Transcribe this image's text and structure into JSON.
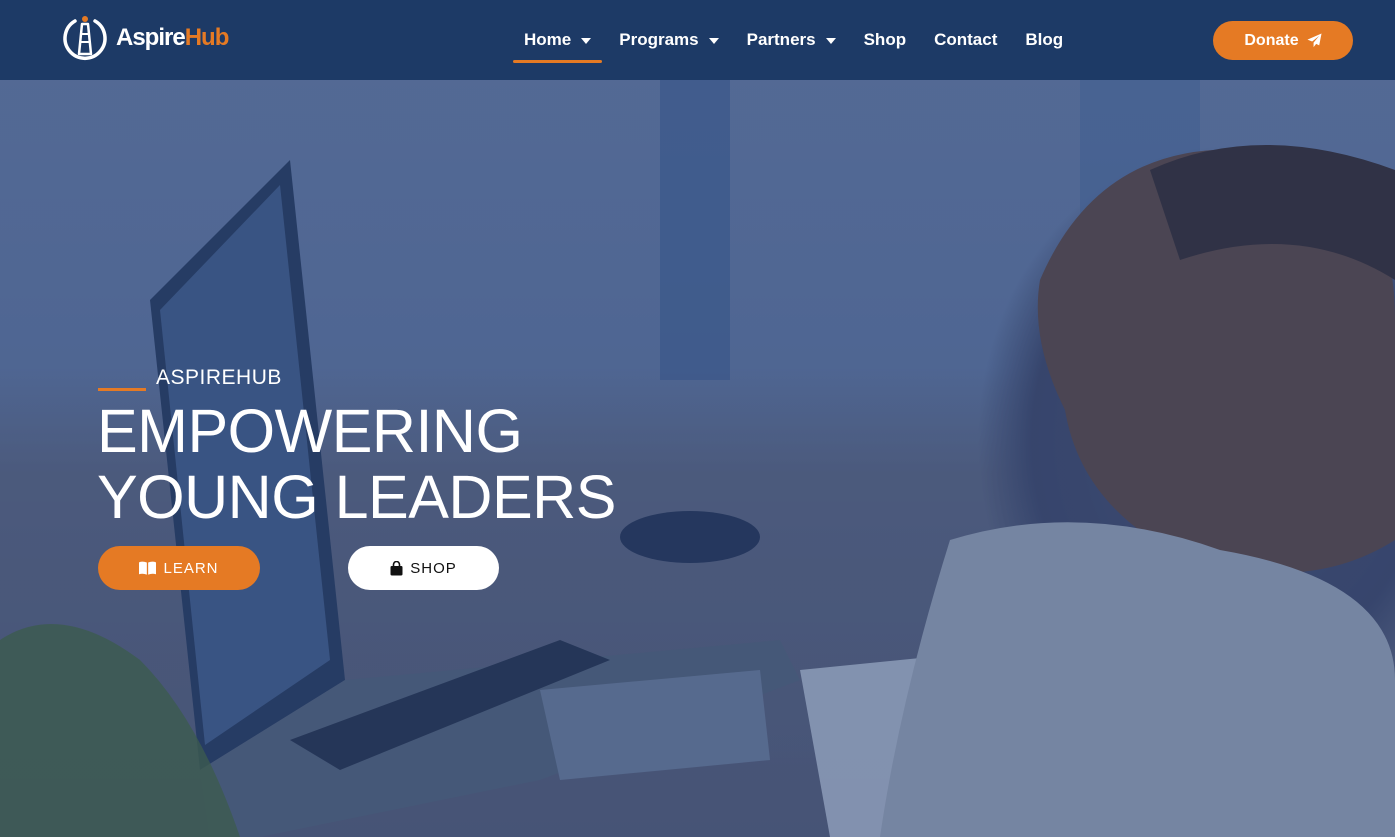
{
  "brand": {
    "name_part1": "Aspire",
    "name_part2": "Hub",
    "accent_color": "#e57a24",
    "nav_bg": "#1d3a66",
    "logo_icon": "lighthouse-logo-icon"
  },
  "nav": {
    "items": [
      {
        "label": "Home",
        "has_dropdown": true,
        "active": true
      },
      {
        "label": "Programs",
        "has_dropdown": true,
        "active": false
      },
      {
        "label": "Partners",
        "has_dropdown": true,
        "active": false
      },
      {
        "label": "Shop",
        "has_dropdown": false,
        "active": false
      },
      {
        "label": "Contact",
        "has_dropdown": false,
        "active": false
      },
      {
        "label": "Blog",
        "has_dropdown": false,
        "active": false
      }
    ],
    "donate_label": "Donate",
    "donate_icon": "paper-plane-icon"
  },
  "hero": {
    "eyebrow": "ASPIREHUB",
    "headline_line1": "EMPOWERING",
    "headline_line2": "YOUNG LEADERS",
    "learn_label": "LEARN",
    "learn_icon": "book-icon",
    "shop_label": "SHOP",
    "shop_icon": "shopping-bag-icon"
  }
}
